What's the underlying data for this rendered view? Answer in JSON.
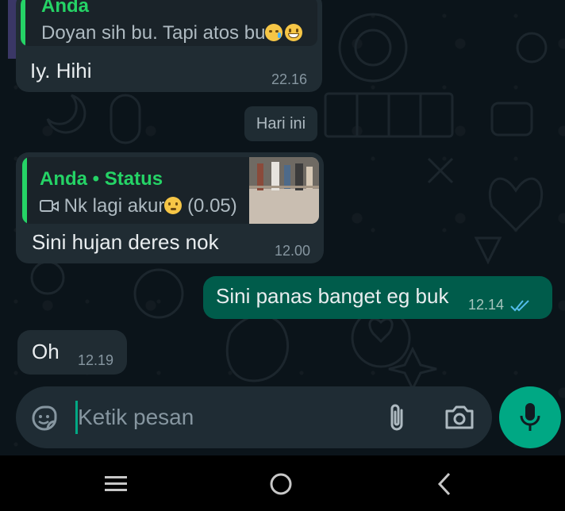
{
  "messages": [
    {
      "id": "msg1",
      "direction": "incoming",
      "quote_author": "Anda",
      "quote_text": "Doyan sih bu. Tapi atos bu",
      "text": "Iy. Hihi",
      "time": "22.16"
    },
    {
      "id": "msg2",
      "direction": "incoming",
      "quote_author": "Anda • Status",
      "quote_text": "Nk lagi akur",
      "quote_duration": "(0.05)",
      "text": "Sini hujan deres nok",
      "time": "12.00"
    },
    {
      "id": "msg3",
      "direction": "outgoing",
      "text": "Sini panas banget eg buk",
      "time": "12.14",
      "status": "read"
    },
    {
      "id": "msg4",
      "direction": "incoming",
      "text": "Oh",
      "time": "12.19"
    }
  ],
  "day_separator": "Hari ini",
  "composer": {
    "placeholder": "Ketik pesan"
  },
  "icons": {
    "sticker": "sticker-icon",
    "attach": "paperclip-icon",
    "camera": "camera-icon",
    "mic": "mic-icon",
    "nav_menu": "recent-apps-icon",
    "nav_home": "home-icon",
    "nav_back": "back-icon"
  },
  "colors": {
    "accent": "#00a884",
    "incoming_bubble": "#202c33",
    "outgoing_bubble": "#005c4b",
    "read_ticks": "#53bdeb"
  }
}
